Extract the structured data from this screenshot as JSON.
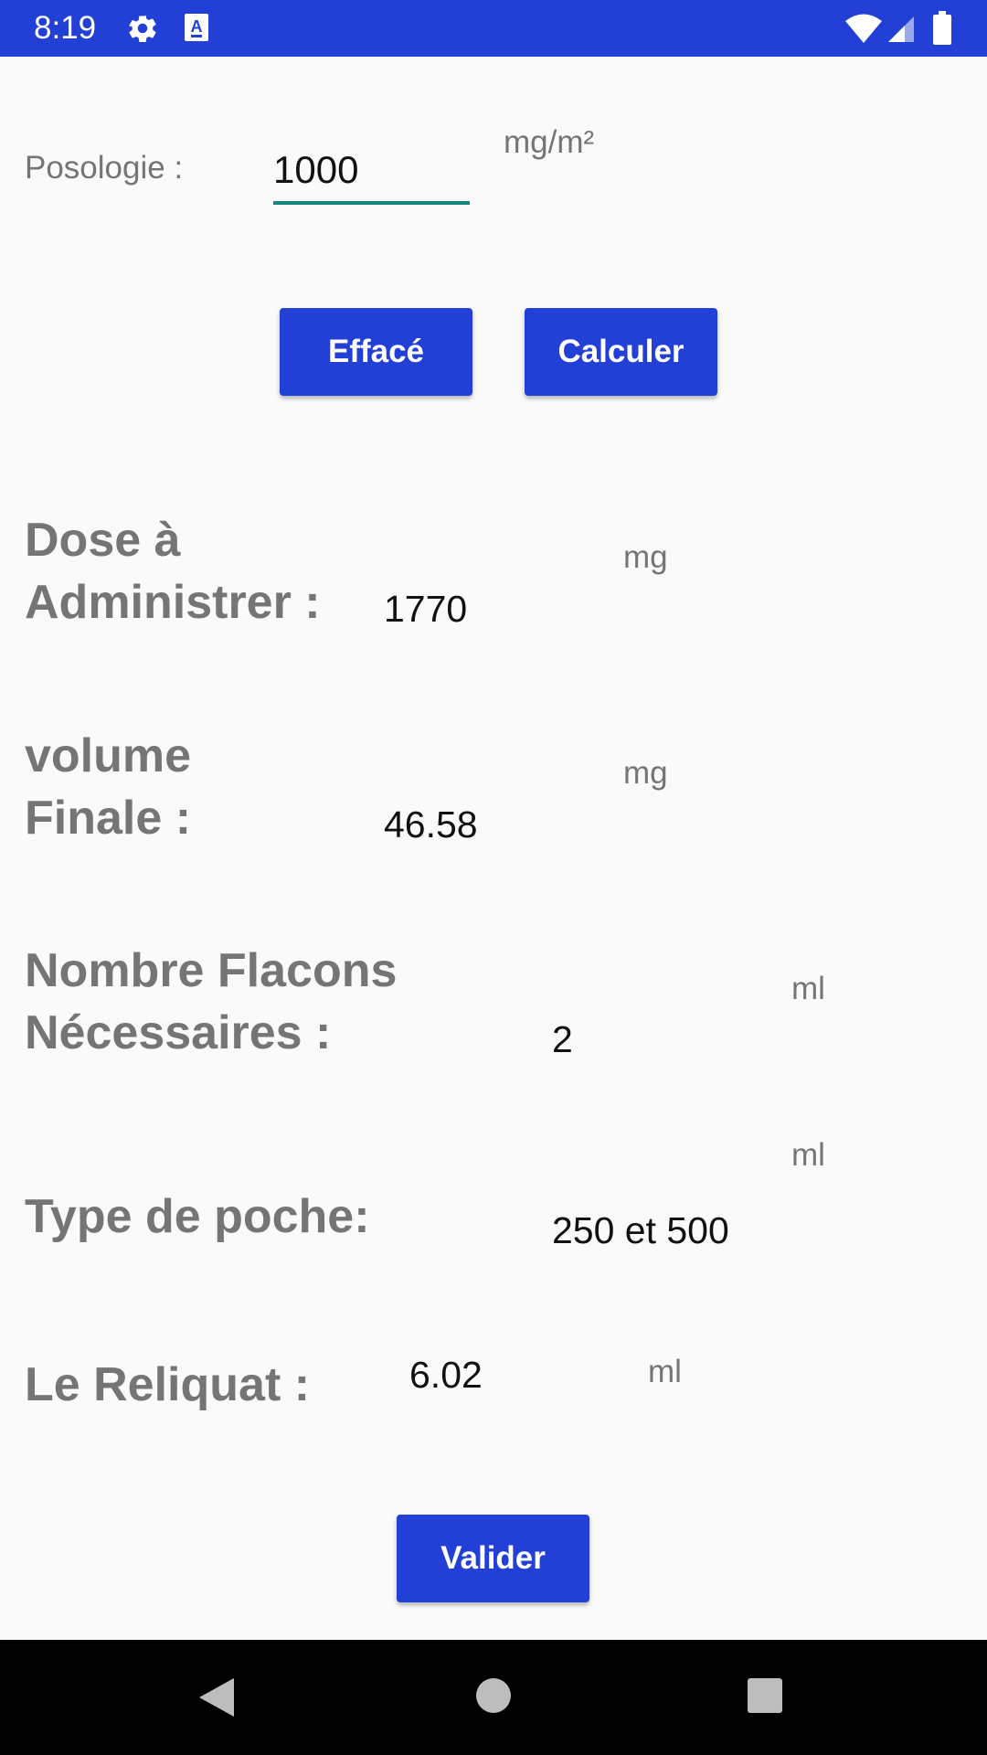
{
  "status_bar": {
    "time": "8:19",
    "icons": [
      "settings-icon",
      "accessibility-icon",
      "wifi-icon",
      "signal-icon",
      "battery-icon"
    ]
  },
  "form": {
    "posologie_label": "Posologie :",
    "posologie_value": "1000",
    "posologie_unit": "mg/m²",
    "clear_button": "Effacé",
    "calculate_button": "Calculer"
  },
  "results": {
    "dose": {
      "label_line1": "Dose à",
      "label_line2": "Administrer :",
      "value": "1770",
      "unit": "mg"
    },
    "volume": {
      "label_line1": "volume",
      "label_line2": "Finale :",
      "value": "46.58",
      "unit": "mg"
    },
    "flacons": {
      "label_line1": "Nombre Flacons",
      "label_line2": "Nécessaires :",
      "value": "2",
      "unit": "ml"
    },
    "poche": {
      "label": "Type de poche:",
      "value": "250 et 500",
      "unit": "ml"
    },
    "reliquat": {
      "label": "Le Reliquat :",
      "value": "6.02",
      "unit": "ml"
    }
  },
  "actions": {
    "validate_button": "Valider"
  },
  "colors": {
    "primary": "#2340d6",
    "input_underline": "#14877c",
    "label_gray": "#757575"
  }
}
